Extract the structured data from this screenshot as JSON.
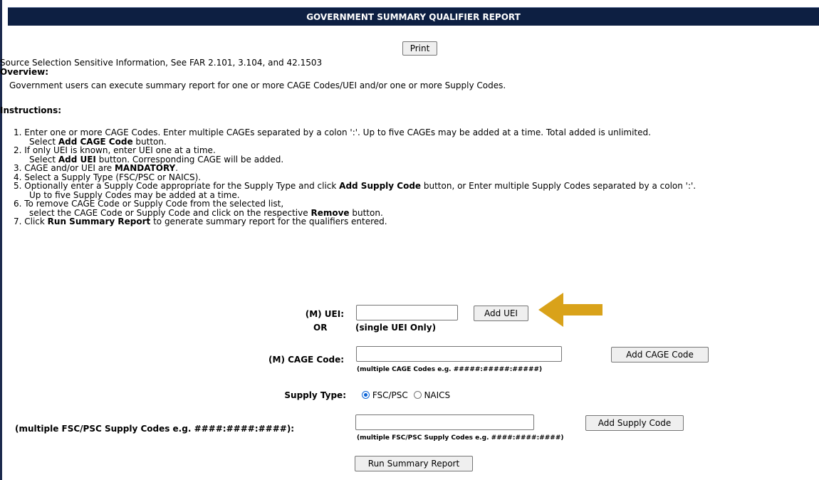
{
  "header": {
    "title": "GOVERNMENT SUMMARY QUALIFIER REPORT"
  },
  "print_label": "Print",
  "sensitive": "Source Selection Sensitive Information, See FAR 2.101, 3.104, and 42.1503",
  "overview": {
    "title": "Overview:",
    "text": "Government users can execute summary report for one or more CAGE Codes/UEI and/or one or more Supply Codes."
  },
  "instructions": {
    "title": "Instructions:",
    "items": [
      {
        "line1": "1. Enter one or more CAGE Codes. Enter multiple CAGEs separated by a colon ':'. Up to five CAGEs may be added at a time. Total added is unlimited.",
        "line2_pre": "Select ",
        "line2_bold": "Add CAGE Code",
        "line2_post": " button."
      },
      {
        "line1": "2. If only UEI is known, enter UEI one at a time.",
        "line2_pre": "Select ",
        "line2_bold": "Add UEI",
        "line2_post": " button. Corresponding CAGE will be added."
      },
      {
        "pre": "3. CAGE and/or UEI are ",
        "bold": "MANDATORY",
        "post": "."
      },
      {
        "text": "4. Select a Supply Type (FSC/PSC or NAICS)."
      },
      {
        "pre": "5. Optionally enter a Supply Code appropriate for the Supply Type and click ",
        "bold": "Add Supply Code",
        "post": " button, or Enter multiple Supply Codes separated by a colon ':'.",
        "line2": "Up to five Supply Codes may be added at a time."
      },
      {
        "line1": "6. To remove CAGE Code or Supply Code from the selected list,",
        "line2_pre": "select the CAGE Code or Supply Code and click on the respective ",
        "line2_bold": "Remove",
        "line2_post": " button."
      },
      {
        "pre": "7. Click ",
        "bold": "Run Summary Report",
        "post": " to generate summary report for the qualifiers entered."
      }
    ]
  },
  "form": {
    "uei_label": "(M) UEI:",
    "or_label": "OR",
    "uei_hint": "(single UEI Only)",
    "uei_value": "",
    "add_uei": "Add UEI",
    "cage_label": "(M) CAGE Code:",
    "cage_value": "",
    "cage_hint": "(multiple CAGE Codes e.g. #####:#####:#####)",
    "add_cage": "Add CAGE Code",
    "supply_type_label": "Supply Type:",
    "supply_options": [
      "FSC/PSC",
      "NAICS"
    ],
    "supply_selected": "FSC/PSC",
    "supply_label": "(multiple FSC/PSC Supply Codes e.g. ####:####:####):",
    "supply_value": "",
    "supply_hint": "(multiple FSC/PSC Supply Codes e.g. ####:####:####)",
    "add_supply": "Add Supply Code",
    "run_report": "Run Summary Report"
  },
  "colors": {
    "header_bg": "#0d1f42",
    "arrow": "#d9a21a",
    "radio_accent": "#0a63d6"
  },
  "annotation": {
    "icon": "arrow-left-icon"
  }
}
